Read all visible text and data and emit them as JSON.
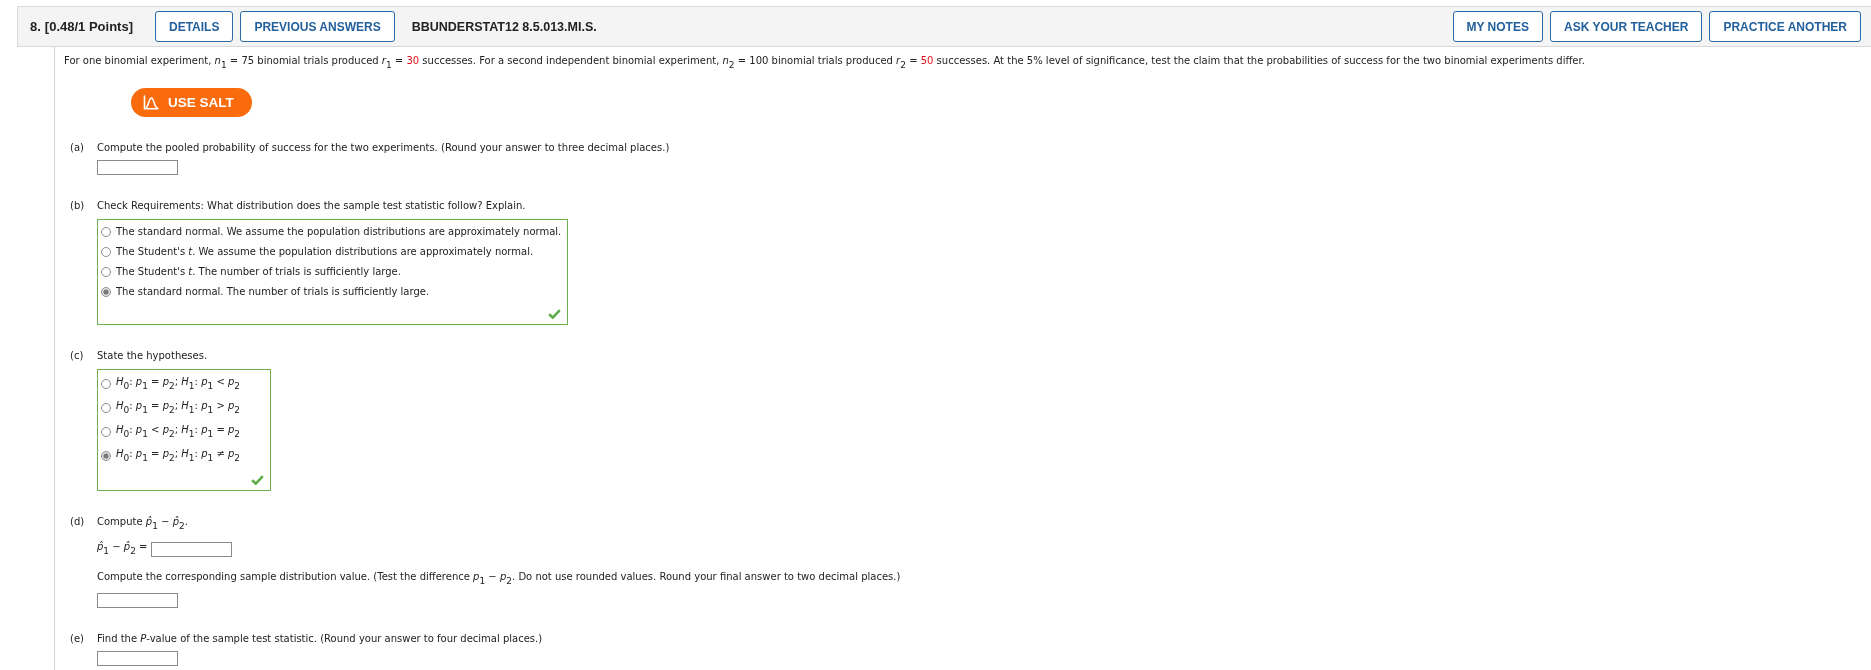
{
  "header": {
    "number": "8.",
    "points": "[0.48/1 Points]",
    "left_buttons": [
      "DETAILS",
      "PREVIOUS ANSWERS"
    ],
    "code": "BBUNDERSTAT12 8.5.013.MI.S.",
    "right_buttons": [
      "MY NOTES",
      "ASK YOUR TEACHER",
      "PRACTICE ANOTHER"
    ]
  },
  "question": {
    "segments": [
      {
        "kind": "text",
        "text": "For one binomial experiment, *n*$_{1}$ = 75 binomial trials produced *r*$_{1}$ = "
      },
      {
        "kind": "value",
        "text": "30"
      },
      {
        "kind": "text",
        "text": " successes. For a second independent binomial experiment, *n*$_{2}$ = 100 binomial trials produced *r*$_{2}$ = "
      },
      {
        "kind": "value",
        "text": "50"
      },
      {
        "kind": "text",
        "text": " successes. At the 5% level of significance, test the claim that the probabilities of success for the two binomial experiments differ."
      }
    ],
    "salt_button": "USE SALT"
  },
  "parts": [
    {
      "label": "(a)",
      "items": [
        {
          "kind": "prompt",
          "text": "Compute the pooled probability of success for the two experiments. (Round your answer to three decimal places.)"
        },
        {
          "kind": "answer_box"
        }
      ]
    },
    {
      "label": "(b)",
      "items": [
        {
          "kind": "prompt",
          "text": "Check Requirements: What distribution does the sample test statistic follow? Explain."
        },
        {
          "kind": "choices",
          "correct": true,
          "options": [
            {
              "text": "The standard normal. We assume the population distributions are approximately normal.",
              "selected": false
            },
            {
              "text": "The Student's *t*. We assume the population distributions are approximately normal.",
              "selected": false
            },
            {
              "text": "The Student's *t*. The number of trials is sufficiently large.",
              "selected": false
            },
            {
              "text": "The standard normal. The number of trials is sufficiently large.",
              "selected": true
            }
          ]
        }
      ]
    },
    {
      "label": "(c)",
      "items": [
        {
          "kind": "prompt",
          "text": "State the hypotheses."
        },
        {
          "kind": "choices",
          "correct": true,
          "options": [
            {
              "text": "*H*$_{0}$: *p*$_{1}$ = *p*$_{2}$; *H*$_{1}$: *p*$_{1}$ < *p*$_{2}$",
              "selected": false
            },
            {
              "text": "*H*$_{0}$: *p*$_{1}$ = *p*$_{2}$; *H*$_{1}$: *p*$_{1}$ > *p*$_{2}$",
              "selected": false
            },
            {
              "text": "*H*$_{0}$: *p*$_{1}$ < *p*$_{2}$; *H*$_{1}$: *p*$_{1}$ = *p*$_{2}$",
              "selected": false
            },
            {
              "text": "*H*$_{0}$: *p*$_{1}$ = *p*$_{2}$; *H*$_{1}$: *p*$_{1}$ ≠ *p*$_{2}$",
              "selected": true
            }
          ]
        }
      ]
    },
    {
      "label": "(d)",
      "items": [
        {
          "kind": "prompt",
          "text": "Compute *p̂*$_{1}$ − *p̂*$_{2}$."
        },
        {
          "kind": "equation",
          "text": "*p̂*$_{1}$ − *p̂*$_{2}$ ="
        },
        {
          "kind": "prompt",
          "text": "Compute the corresponding sample distribution value. (Test the difference *p*$_{1}$ − *p*$_{2}$. Do not use rounded values. Round your final answer to two decimal places.)"
        },
        {
          "kind": "answer_box"
        }
      ]
    },
    {
      "label": "(e)",
      "items": [
        {
          "kind": "prompt",
          "text": "Find the *P*-value of the sample test statistic. (Round your answer to four decimal places.)"
        },
        {
          "kind": "answer_box"
        }
      ]
    }
  ]
}
